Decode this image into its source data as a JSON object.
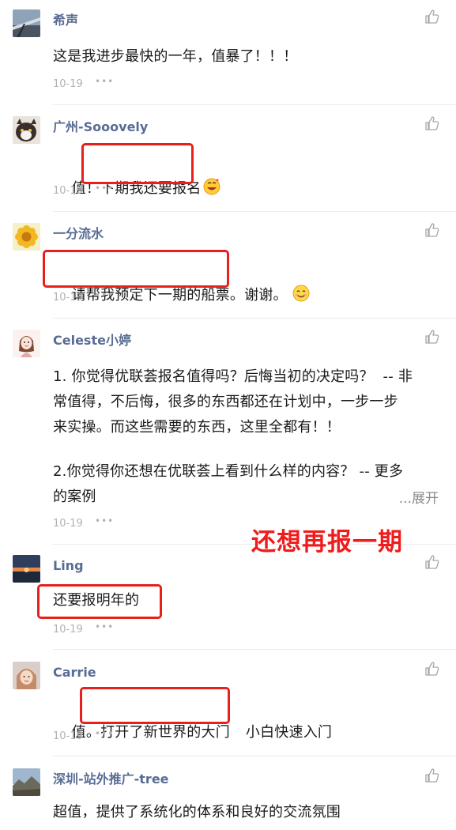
{
  "comments": [
    {
      "name": "希声",
      "text": "这是我进步最快的一年，值暴了！！！",
      "date": "10-19"
    },
    {
      "name": "广州-Sooovely",
      "text_prefix": "值！",
      "text_highlight": "下期我还要报名",
      "emoji": "grinning-face-with-hearts",
      "date": "10-19"
    },
    {
      "name": "一分流水",
      "text_highlight": "请帮我预定下一期的船票",
      "text_suffix": "。谢谢。",
      "emoji": "smiling-face",
      "date": "10-19"
    },
    {
      "name": "Celeste小婷",
      "text_line1": "1. 你觉得优联荟报名值得吗？后悔当初的决定吗？  -- 非",
      "text_line2": "常值得，不后悔，很多的东西都还在计划中，一步一步",
      "text_line3": "来实操。而这些需要的东西，这里全都有！！",
      "text_line4": "2.你觉得你还想在优联荟上看到什么样的内容？ -- 更多",
      "text_line5": "的案例",
      "expand_label": "...展开",
      "date": "10-19"
    },
    {
      "name": "Ling",
      "text_highlight": "还要报明年的",
      "date": "10-19"
    },
    {
      "name": "Carrie",
      "text_prefix": "值。",
      "text_highlight": "打开了新世界的大门",
      "text_suffix": "小白快速入门",
      "date": "10-19"
    },
    {
      "name": "深圳-站外推广-tree",
      "text": "超值，提供了系统化的体系和良好的交流氛围"
    }
  ],
  "annotation": "还想再报一期",
  "more_icon": "ellipsis-icon",
  "like_icon": "thumbs-up-icon",
  "colors": {
    "name": "#586c94",
    "highlight": "#e8201c",
    "meta": "#b2b2b2"
  }
}
